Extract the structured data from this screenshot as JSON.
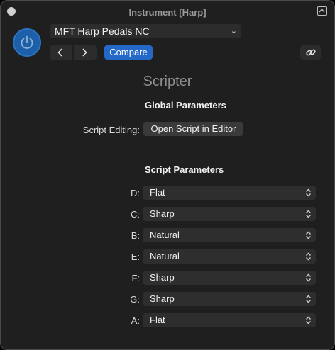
{
  "window": {
    "title": "Instrument [Harp]"
  },
  "header": {
    "preset_name": "MFT Harp Pedals NC",
    "compare_label": "Compare"
  },
  "plugin": {
    "name": "Scripter",
    "global_heading": "Global Parameters",
    "script_editing_label": "Script Editing:",
    "open_editor_label": "Open Script in Editor",
    "script_heading": "Script Parameters"
  },
  "params": [
    {
      "label": "D:",
      "value": "Flat"
    },
    {
      "label": "C:",
      "value": "Sharp"
    },
    {
      "label": "B:",
      "value": "Natural"
    },
    {
      "label": "E:",
      "value": "Natural"
    },
    {
      "label": "F:",
      "value": "Sharp"
    },
    {
      "label": "G:",
      "value": "Sharp"
    },
    {
      "label": "A:",
      "value": "Flat"
    }
  ],
  "colors": {
    "accent": "#2468c8",
    "power": "#1d5fa8",
    "background": "#1f1f1f"
  },
  "icons": {
    "close": "close-dot-icon",
    "expand": "expand-icon",
    "power": "power-icon",
    "prev": "chevron-left-icon",
    "next": "chevron-right-icon",
    "link": "link-icon",
    "select": "up-down-chevron-icon"
  }
}
